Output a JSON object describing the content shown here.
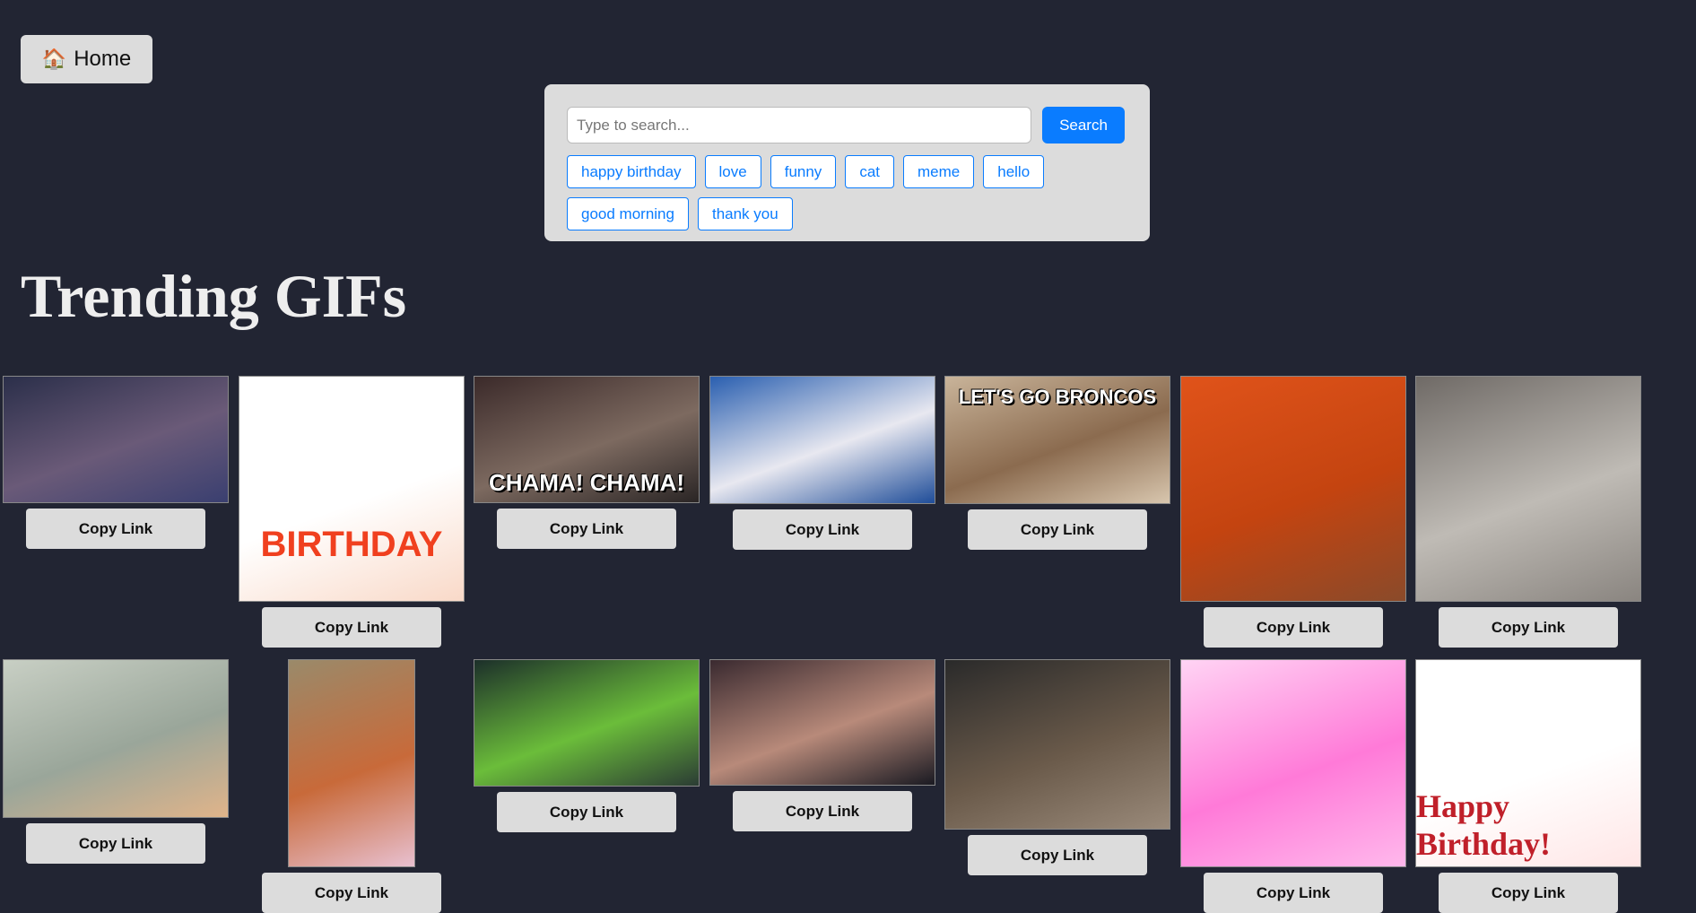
{
  "home": {
    "icon": "house-icon",
    "glyph": "🏠",
    "label": "Home"
  },
  "search": {
    "placeholder": "Type to search...",
    "value": "",
    "button_label": "Search",
    "tags": [
      "happy birthday",
      "love",
      "funny",
      "cat",
      "meme",
      "hello",
      "good morning",
      "thank you"
    ]
  },
  "page_title": "Trending GIFs",
  "copy_label": "Copy Link",
  "colors": {
    "background": "#222533",
    "panel": "#dcdcdc",
    "accent": "#0a7cff"
  },
  "gifs": [
    {
      "name": "gif-crowd-man",
      "caption": "",
      "palette": [
        "#2b2f4a",
        "#6a5a78",
        "#3a3f70"
      ]
    },
    {
      "name": "gif-birthday-hamster",
      "caption": "BIRTHDAY",
      "palette": [
        "#ffffff",
        "#ffffff",
        "#f9d9c8"
      ]
    },
    {
      "name": "gif-chama-fighter",
      "caption": "CHAMA! CHAMA!",
      "palette": [
        "#3b2a2a",
        "#7d6a60",
        "#2a2525"
      ]
    },
    {
      "name": "gif-blue-jays-player",
      "caption": "",
      "palette": [
        "#2a5fb0",
        "#e8e8f0",
        "#1f4d99"
      ]
    },
    {
      "name": "gif-broncos-horse",
      "caption": "LET'S GO BRONCOS",
      "palette": [
        "#c9b49a",
        "#8b6b4f",
        "#d8c6ae"
      ]
    },
    {
      "name": "gif-mr-bean-party",
      "caption": "",
      "palette": [
        "#e0531a",
        "#c44410",
        "#8a4a2a"
      ]
    },
    {
      "name": "gif-wine-laughing",
      "caption": "",
      "palette": [
        "#6f6a66",
        "#bfbbb5",
        "#8a8580"
      ]
    },
    {
      "name": "gif-sad-baby",
      "caption": "",
      "palette": [
        "#c8cfc4",
        "#9aa69a",
        "#e0b48a"
      ]
    },
    {
      "name": "gif-red-panda-flowers",
      "caption": "",
      "palette": [
        "#9a8a6a",
        "#c86a3a",
        "#e8c0d0"
      ]
    },
    {
      "name": "gif-seahawks-player",
      "caption": "",
      "palette": [
        "#1c2f2a",
        "#6bbd3a",
        "#2b3c34"
      ]
    },
    {
      "name": "gif-fighter-arena",
      "caption": "",
      "palette": [
        "#3a2a30",
        "#b88a7a",
        "#1a1a22"
      ]
    },
    {
      "name": "gif-laughing-chimp",
      "caption": "",
      "palette": [
        "#2a2a2a",
        "#6a5a4a",
        "#9a8a7a"
      ]
    },
    {
      "name": "gif-pink-hearts-frog",
      "caption": "",
      "palette": [
        "#ffd4f4",
        "#ff7ad8",
        "#ffb8ec"
      ]
    },
    {
      "name": "gif-happy-birthday-balloons",
      "caption": "Happy Birthday!",
      "palette": [
        "#ffffff",
        "#ffffff",
        "#ffe6e6"
      ]
    }
  ]
}
